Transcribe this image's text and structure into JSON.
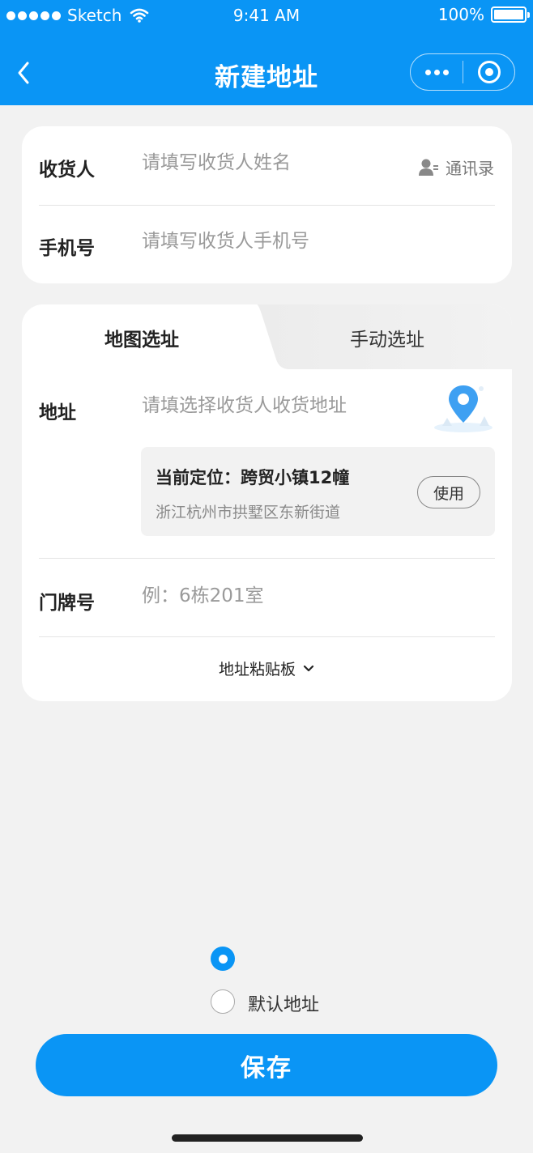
{
  "status_bar": {
    "carrier": "Sketch",
    "time": "9:41 AM",
    "battery": "100%"
  },
  "nav": {
    "title": "新建地址",
    "back_icon": "chevron-left-icon",
    "more_icon": "more-dots-icon",
    "close_icon": "target-ring-icon"
  },
  "contact_card": {
    "receiver_label": "收货人",
    "receiver_placeholder": "请填写收货人姓名",
    "contacts_label": "通讯录",
    "phone_label": "手机号",
    "phone_placeholder": "请填写收货人手机号"
  },
  "address_card": {
    "tabs": [
      {
        "label": "地图选址",
        "active": true
      },
      {
        "label": "手动选址",
        "active": false
      }
    ],
    "address_label": "地址",
    "address_placeholder": "请填选择收货人收货地址",
    "current_location_title": "当前定位：跨贸小镇12幢",
    "current_location_sub": "浙江杭州市拱墅区东新街道",
    "use_button": "使用",
    "house_label": "门牌号",
    "house_placeholder": "例：6栋201室",
    "paste_label": "地址粘贴板"
  },
  "default_label": "默认地址",
  "save_button": "保存",
  "colors": {
    "primary": "#0a95f5",
    "background": "#f2f2f2"
  }
}
